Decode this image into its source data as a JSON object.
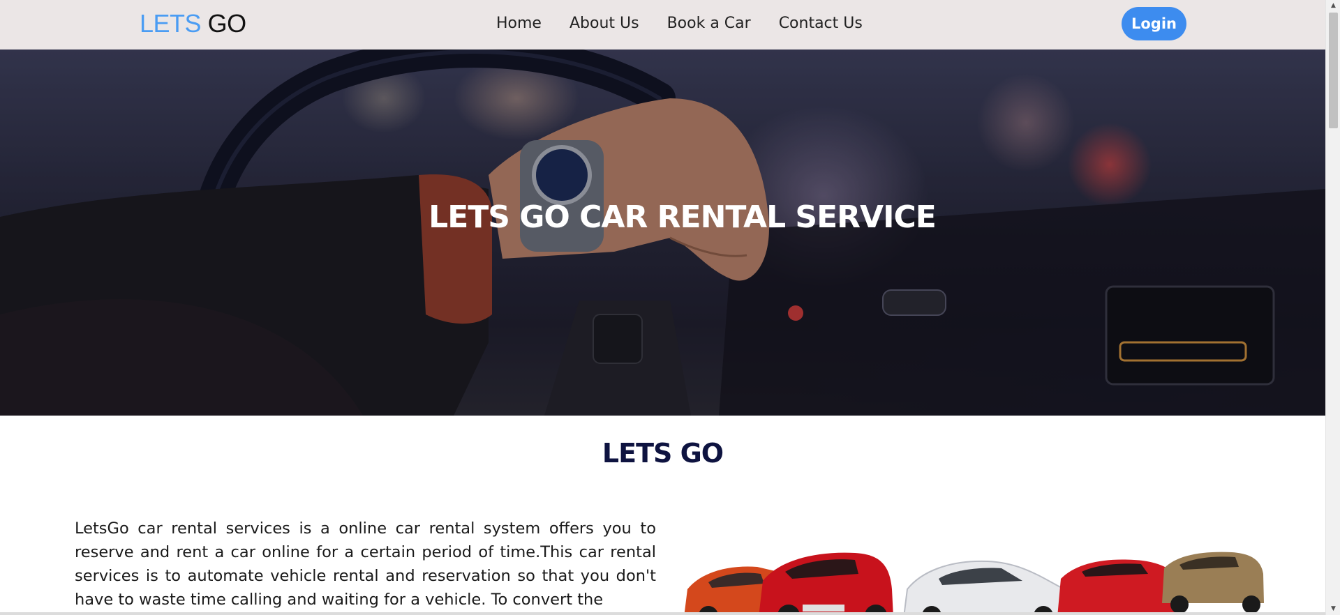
{
  "nav": {
    "brand_part1": "LETS",
    "brand_part2": "GO",
    "links": [
      "Home",
      "About Us",
      "Book a Car",
      "Contact Us"
    ],
    "login_label": "Login"
  },
  "hero": {
    "title": "LETS GO CAR RENTAL SERVICE"
  },
  "about": {
    "title": "LETS GO",
    "text": "LetsGo car rental services is a online car rental system offers you to reserve and rent a car online for a certain period of time.This car rental services is to automate vehicle rental and reservation so that you don't have to waste time calling and waiting for a vehicle. To convert the"
  },
  "colors": {
    "brand_blue": "#4a9cf3",
    "login_blue": "#3d8cef",
    "navbar_bg": "#ebe6e6",
    "heading_navy": "#0e1340"
  },
  "icons": {
    "scroll_up": "triangle-up",
    "scroll_down": "triangle-down"
  }
}
